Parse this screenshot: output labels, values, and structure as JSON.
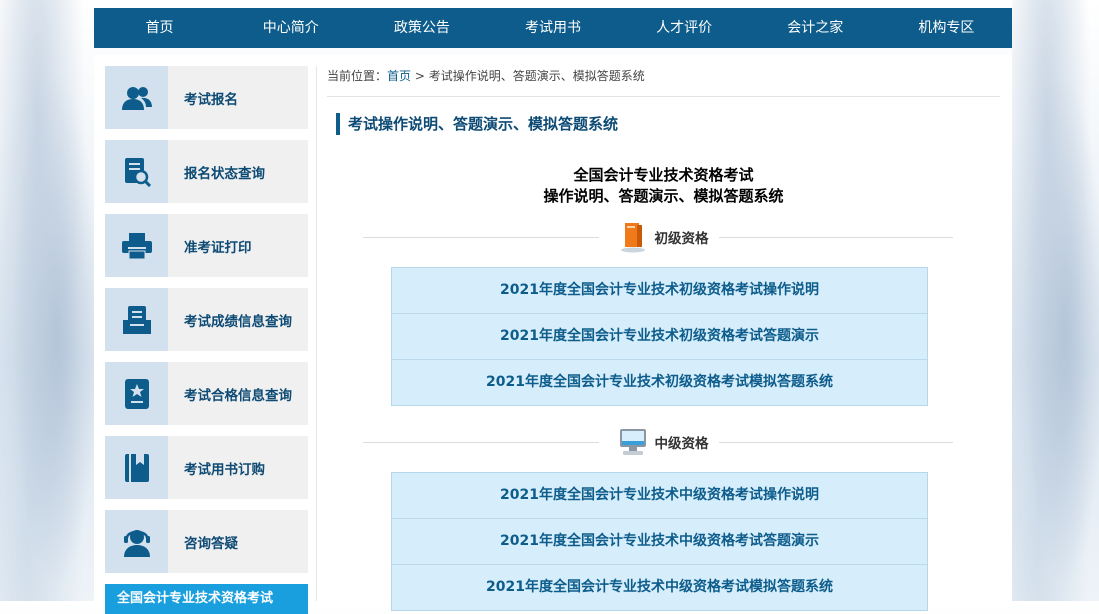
{
  "nav": {
    "items": [
      "首页",
      "中心简介",
      "政策公告",
      "考试用书",
      "人才评价",
      "会计之家",
      "机构专区"
    ]
  },
  "sidebar": {
    "items": [
      {
        "label": "考试报名",
        "icon": "users-icon"
      },
      {
        "label": "报名状态查询",
        "icon": "document-search-icon"
      },
      {
        "label": "准考证打印",
        "icon": "printer-icon"
      },
      {
        "label": "考试成绩信息查询",
        "icon": "inbox-icon"
      },
      {
        "label": "考试合格信息查询",
        "icon": "certificate-icon"
      },
      {
        "label": "考试用书订购",
        "icon": "book-icon"
      },
      {
        "label": "咨询答疑",
        "icon": "headset-icon"
      }
    ],
    "banner": "全国会计专业技术资格考试"
  },
  "breadcrumb": {
    "prefix": "当前位置：",
    "home": "首页",
    "separator": " > ",
    "current": "考试操作说明、答题演示、模拟答题系统"
  },
  "section_title": "考试操作说明、答题演示、模拟答题系统",
  "main_title": {
    "line1": "全国会计专业技术资格考试",
    "line2": "操作说明、答题演示、模拟答题系统"
  },
  "groups": [
    {
      "label": "初级资格",
      "icon": "books-icon",
      "links": [
        "2021年度全国会计专业技术初级资格考试操作说明",
        "2021年度全国会计专业技术初级资格考试答题演示",
        "2021年度全国会计专业技术初级资格考试模拟答题系统"
      ]
    },
    {
      "label": "中级资格",
      "icon": "computer-icon",
      "links": [
        "2021年度全国会计专业技术中级资格考试操作说明",
        "2021年度全国会计专业技术中级资格考试答题演示",
        "2021年度全国会计专业技术中级资格考试模拟答题系统"
      ]
    }
  ],
  "colors": {
    "nav_bg": "#0d5c8b",
    "link_bg": "#d6eefb",
    "sidebar_icon_bg": "#d2e1ed",
    "banner_bg": "#1a9fde"
  }
}
